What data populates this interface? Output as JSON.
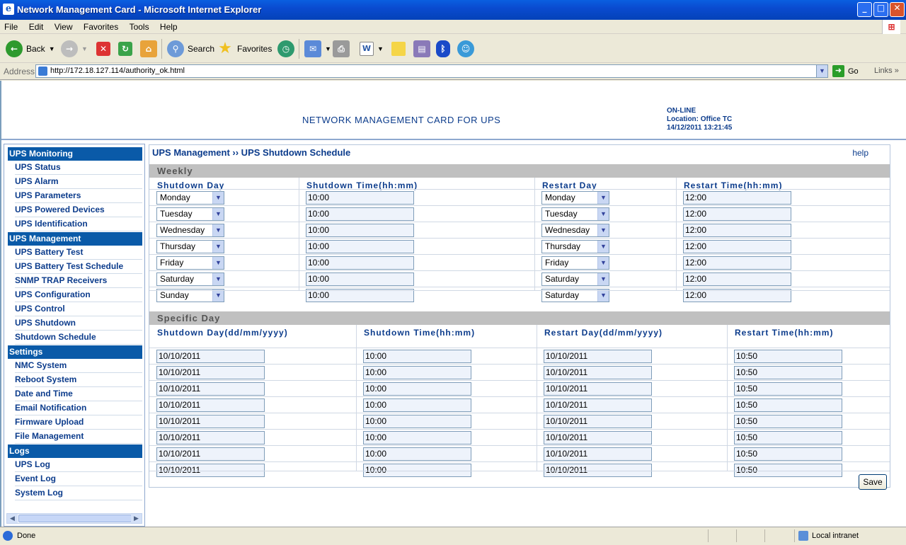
{
  "window": {
    "title": "Network Management Card - Microsoft Internet Explorer"
  },
  "menu": [
    "File",
    "Edit",
    "View",
    "Favorites",
    "Tools",
    "Help"
  ],
  "toolbar": {
    "back": "Back",
    "search": "Search",
    "favorites": "Favorites"
  },
  "address": {
    "label": "Address",
    "url": "http://172.18.127.114/authority_ok.html",
    "go": "Go",
    "links": "Links"
  },
  "header": {
    "title": "NETWORK MANAGEMENT CARD FOR UPS",
    "status": "ON-LINE",
    "location": "Location: Office TC",
    "datetime": "14/12/2011 13:21:45"
  },
  "sidebar": {
    "sections": [
      {
        "title": "UPS Monitoring",
        "items": [
          "UPS Status",
          "UPS Alarm",
          "UPS Parameters",
          "UPS Powered Devices",
          "UPS Identification"
        ]
      },
      {
        "title": "UPS Management",
        "items": [
          "UPS Battery Test",
          "UPS Battery Test Schedule",
          "SNMP TRAP Receivers",
          "UPS Configuration",
          "UPS Control",
          "UPS Shutdown",
          "Shutdown Schedule"
        ]
      },
      {
        "title": "Settings",
        "items": [
          "NMC System",
          "Reboot System",
          "Date and Time",
          "Email Notification",
          "Firmware Upload",
          "File Management"
        ]
      },
      {
        "title": "Logs",
        "items": [
          "UPS Log",
          "Event Log",
          "System Log"
        ]
      }
    ]
  },
  "main": {
    "breadcrumb": "UPS Management ›› UPS Shutdown Schedule",
    "help": "help",
    "weekly": {
      "title": "Weekly",
      "headers": [
        "Shutdown Day",
        "Shutdown Time(hh:mm)",
        "Restart Day",
        "Restart Time(hh:mm)"
      ],
      "rows": [
        [
          "Monday",
          "10:00",
          "Monday",
          "12:00"
        ],
        [
          "Tuesday",
          "10:00",
          "Tuesday",
          "12:00"
        ],
        [
          "Wednesday",
          "10:00",
          "Wednesday",
          "12:00"
        ],
        [
          "Thursday",
          "10:00",
          "Thursday",
          "12:00"
        ],
        [
          "Friday",
          "10:00",
          "Friday",
          "12:00"
        ],
        [
          "Saturday",
          "10:00",
          "Saturday",
          "12:00"
        ],
        [
          "Sunday",
          "10:00",
          "Saturday",
          "12:00"
        ]
      ]
    },
    "specific": {
      "title": "Specific Day",
      "headers": [
        "Shutdown Day(dd/mm/yyyy)",
        "Shutdown Time(hh:mm)",
        "Restart Day(dd/mm/yyyy)",
        "Restart Time(hh:mm)"
      ],
      "rows": [
        [
          "10/10/2011",
          "10:00",
          "10/10/2011",
          "10:50"
        ],
        [
          "10/10/2011",
          "10:00",
          "10/10/2011",
          "10:50"
        ],
        [
          "10/10/2011",
          "10:00",
          "10/10/2011",
          "10:50"
        ],
        [
          "10/10/2011",
          "10:00",
          "10/10/2011",
          "10:50"
        ],
        [
          "10/10/2011",
          "10:00",
          "10/10/2011",
          "10:50"
        ],
        [
          "10/10/2011",
          "10:00",
          "10/10/2011",
          "10:50"
        ],
        [
          "10/10/2011",
          "10:00",
          "10/10/2011",
          "10:50"
        ],
        [
          "10/10/2011",
          "10:00",
          "10/10/2011",
          "10:50"
        ]
      ]
    },
    "save": "Save"
  },
  "statusbar": {
    "status": "Done",
    "zone": "Local intranet"
  },
  "colors": {
    "accent": "#0a5aa8",
    "link": "#0c3c8c",
    "band": "#c0c0c0"
  }
}
